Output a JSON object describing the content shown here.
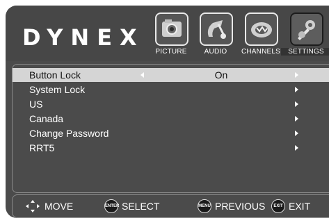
{
  "brand": "DYNEX",
  "tabs": [
    {
      "label": "PICTURE",
      "icon": "picture-icon"
    },
    {
      "label": "AUDIO",
      "icon": "audio-icon"
    },
    {
      "label": "CHANNELS",
      "icon": "channels-icon"
    },
    {
      "label": "SETTINGS",
      "icon": "settings-icon",
      "active": true
    }
  ],
  "menu": {
    "items": [
      {
        "label": "Button Lock",
        "value": "On",
        "selected": true
      },
      {
        "label": "System Lock"
      },
      {
        "label": "US"
      },
      {
        "label": "Canada"
      },
      {
        "label": "Change Password"
      },
      {
        "label": "RRT5"
      }
    ]
  },
  "footer": {
    "move": "MOVE",
    "select": "SELECT",
    "select_button": "ENTER",
    "previous": "PREVIOUS",
    "previous_button": "MENU",
    "exit": "EXIT",
    "exit_button": "EXIT"
  },
  "colors": {
    "background": "#4b4b4b",
    "selected_row": "#d5d5d5",
    "text": "#ffffff"
  }
}
